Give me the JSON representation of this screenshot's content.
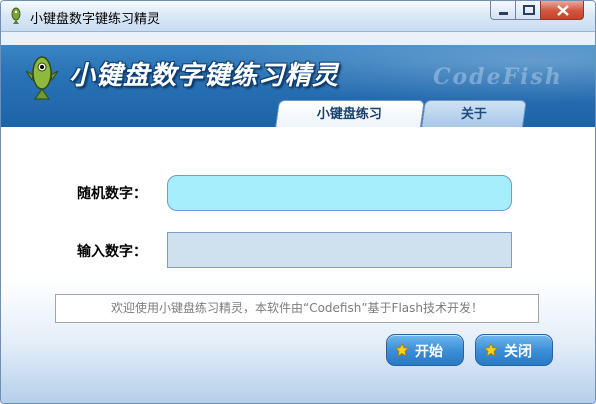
{
  "window": {
    "title": "小键盘数字键练习精灵"
  },
  "banner": {
    "title": "小键盘数字键练习精灵",
    "watermark": "CodeFish"
  },
  "tabs": [
    {
      "label": "小键盘练习",
      "active": true
    },
    {
      "label": "关于",
      "active": false
    }
  ],
  "form": {
    "random_label": "随机数字：",
    "random_value": "",
    "input_label": "输入数字：",
    "input_value": ""
  },
  "message": "欢迎使用小键盘练习精灵，本软件由“Codefish”基于Flash技术开发！",
  "buttons": {
    "start": "开始",
    "close": "关闭"
  },
  "colors": {
    "banner": "#2a73b6",
    "random_field": "#a6eefc",
    "input_field": "#cfe0ee",
    "button": "#3c8fd8"
  }
}
